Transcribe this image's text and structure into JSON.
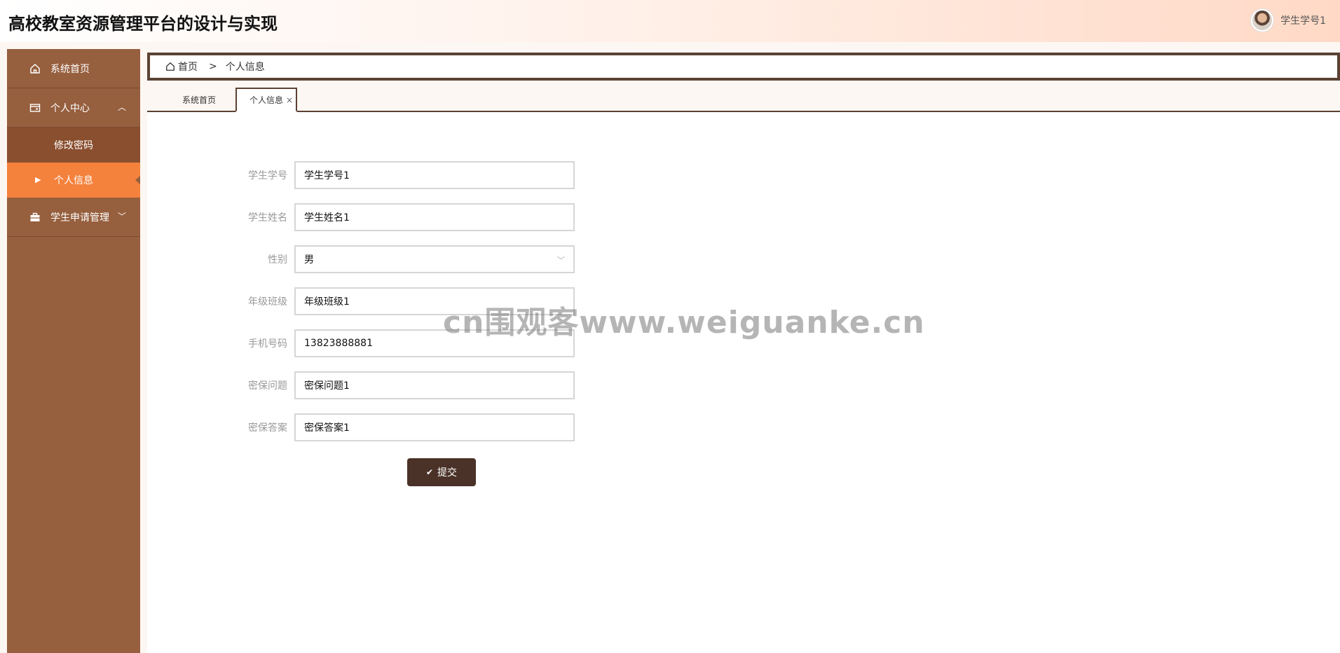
{
  "header": {
    "title": "高校教室资源管理平台的设计与实现",
    "user_name": "学生学号1"
  },
  "sidebar": {
    "items": [
      {
        "label": "系统首页",
        "icon": "home-icon"
      },
      {
        "label": "个人中心",
        "icon": "wallet-icon",
        "expanded": true,
        "children": [
          {
            "label": "修改密码"
          },
          {
            "label": "个人信息",
            "active": true
          }
        ]
      },
      {
        "label": "学生申请管理",
        "icon": "briefcase-icon",
        "expanded": false
      }
    ]
  },
  "breadcrumb": {
    "home": "首页",
    "separator": ">",
    "current": "个人信息"
  },
  "tabs": [
    {
      "label": "系统首页"
    },
    {
      "label": "个人信息",
      "active": true,
      "close": "×"
    }
  ],
  "form": {
    "fields": [
      {
        "label": "学生学号",
        "value": "学生学号1"
      },
      {
        "label": "学生姓名",
        "value": "学生姓名1"
      },
      {
        "label": "性别",
        "value": "男",
        "type": "select"
      },
      {
        "label": "年级班级",
        "value": "年级班级1"
      },
      {
        "label": "手机号码",
        "value": "13823888881"
      },
      {
        "label": "密保问题",
        "value": "密保问题1"
      },
      {
        "label": "密保答案",
        "value": "密保答案1"
      }
    ],
    "submit_label": "提交"
  },
  "watermark": "cn围观客www.weiguanke.cn",
  "colors": {
    "sidebar_bg": "#965f3e",
    "sidebar_active": "#f4823d",
    "accent_dark": "#5b4233",
    "button_bg": "#4a3228"
  }
}
